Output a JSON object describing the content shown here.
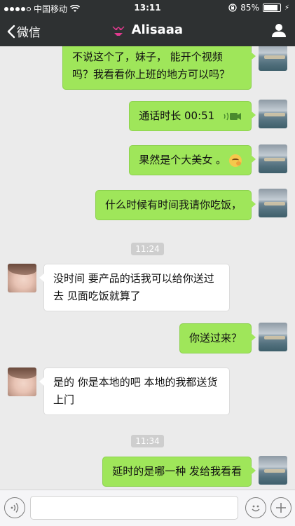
{
  "status_bar": {
    "carrier": "中国移动",
    "time": "13:11",
    "battery": "85%",
    "battery_level": 0.85
  },
  "nav": {
    "back_label": "微信",
    "title": "Alisaaa"
  },
  "messages": [
    {
      "side": "right",
      "text": "不说这个了，妹子，  能开个视频吗？我看看你上班的地方可以吗？"
    },
    {
      "side": "right",
      "text": "通话时长 00:51",
      "type": "call"
    },
    {
      "side": "right",
      "text": "果然是个大美女  。",
      "emoji": "think-emoji"
    },
    {
      "side": "right",
      "text": "什么时候有时间我请你吃饭，"
    },
    {
      "type": "timestamp",
      "text": "11:24"
    },
    {
      "side": "left",
      "text": "没时间 要产品的话我可以给你送过去 见面吃饭就算了"
    },
    {
      "side": "right",
      "text": "你送过来？"
    },
    {
      "side": "left",
      "text": "是的 你是本地的吧 本地的我都送货上门"
    },
    {
      "type": "timestamp",
      "text": "11:34"
    },
    {
      "side": "right",
      "text": "延时的是哪一种 发给我看看"
    }
  ],
  "input": {
    "value": ""
  }
}
